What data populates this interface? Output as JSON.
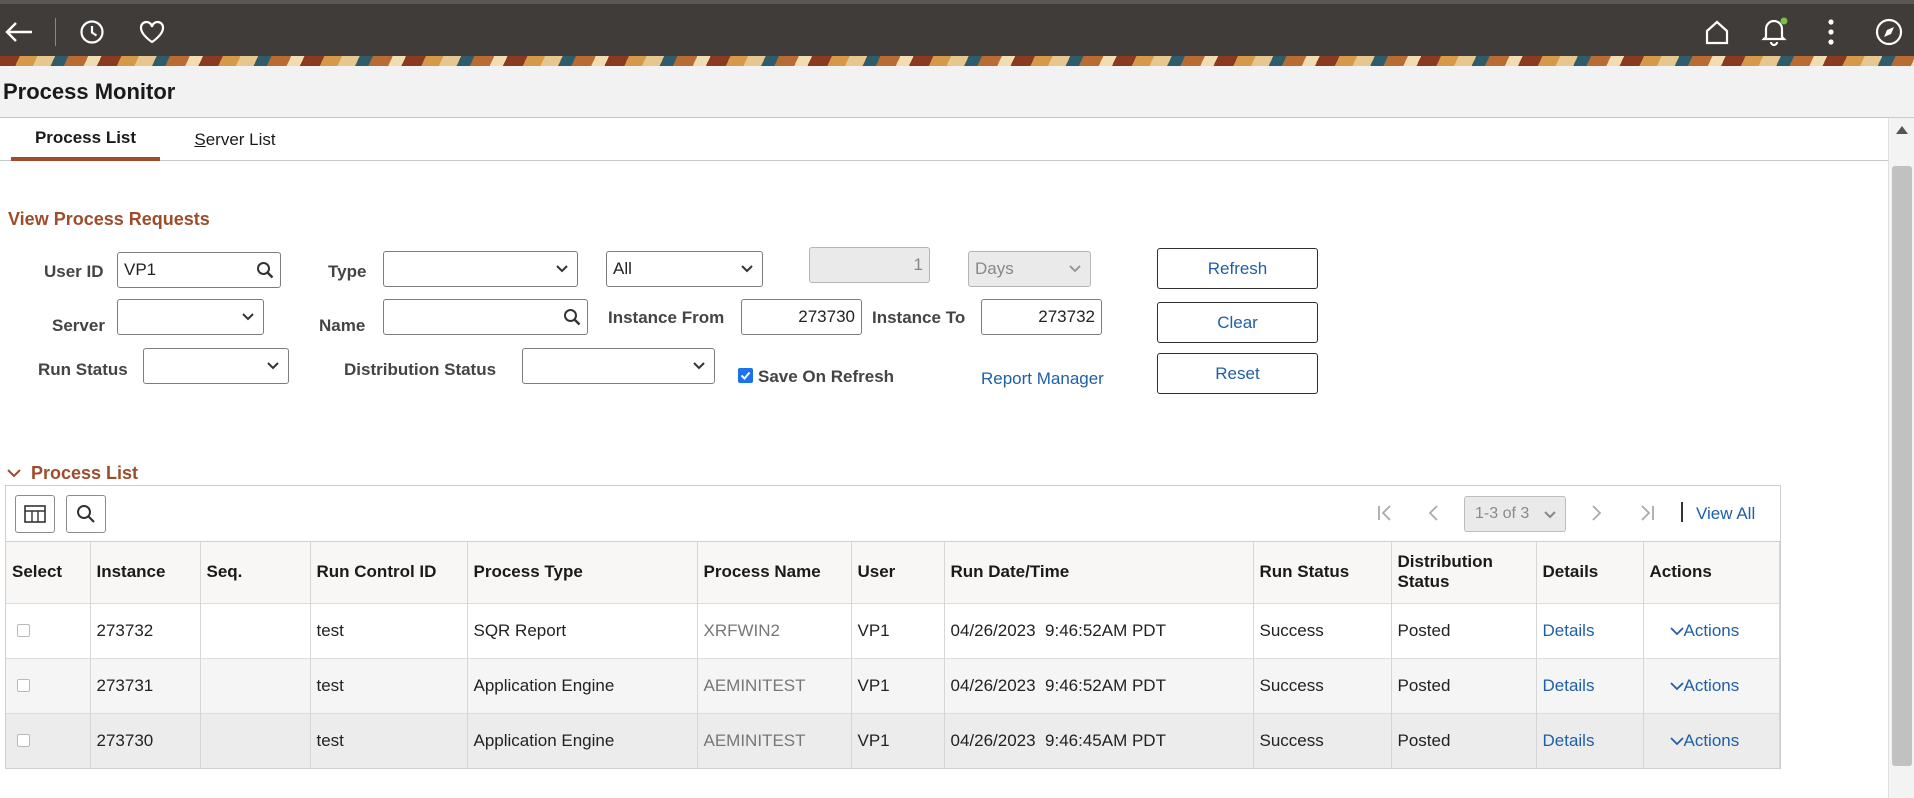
{
  "page": {
    "title": "Process Monitor"
  },
  "tabs": [
    {
      "label": "Process List",
      "active": true
    },
    {
      "label": "Server List",
      "active": false,
      "mnemonic": "S"
    }
  ],
  "filters": {
    "section_title": "View Process Requests",
    "user_id_label": "User ID",
    "user_id_value": "VP1",
    "type_label": "Type",
    "type_value": "",
    "scope_value": "All",
    "days_value": "1",
    "days_unit": "Days",
    "server_label": "Server",
    "server_value": "",
    "name_label": "Name",
    "name_value": "",
    "instance_from_label": "Instance From",
    "instance_from_value": "273730",
    "instance_to_label": "Instance To",
    "instance_to_value": "273732",
    "run_status_label": "Run Status",
    "run_status_value": "",
    "dist_status_label": "Distribution Status",
    "dist_status_value": "",
    "save_on_refresh_label": "Save On Refresh",
    "save_on_refresh_checked": true,
    "report_manager_link": "Report Manager"
  },
  "buttons": {
    "refresh": "Refresh",
    "clear": "Clear",
    "reset": "Reset"
  },
  "grid": {
    "title": "Process List",
    "pagination": "1-3 of 3",
    "view_all": "View All",
    "columns": [
      "Select",
      "Instance",
      "Seq.",
      "Run Control ID",
      "Process Type",
      "Process Name",
      "User",
      "Run Date/Time",
      "Run Status",
      "Distribution Status",
      "Details",
      "Actions"
    ],
    "rows": [
      {
        "instance": "273732",
        "seq": "",
        "run_control": "test",
        "process_type": "SQR Report",
        "process_name": "XRFWIN2",
        "user": "VP1",
        "run_datetime": "04/26/2023  9:46:52AM PDT",
        "run_status": "Success",
        "dist_status": "Posted",
        "details": "Details",
        "actions": "Actions"
      },
      {
        "instance": "273731",
        "seq": "",
        "run_control": "test",
        "process_type": "Application Engine",
        "process_name": "AEMINITEST",
        "user": "VP1",
        "run_datetime": "04/26/2023  9:46:52AM PDT",
        "run_status": "Success",
        "dist_status": "Posted",
        "details": "Details",
        "actions": "Actions"
      },
      {
        "instance": "273730",
        "seq": "",
        "run_control": "test",
        "process_type": "Application Engine",
        "process_name": "AEMINITEST",
        "user": "VP1",
        "run_datetime": "04/26/2023  9:46:45AM PDT",
        "run_status": "Success",
        "dist_status": "Posted",
        "details": "Details",
        "actions": "Actions"
      }
    ]
  },
  "icons": {
    "back": "back-arrow-icon",
    "history": "clock-icon",
    "favorites": "heart-icon",
    "home": "home-icon",
    "notifications": "bell-icon",
    "more": "kebab-menu-icon",
    "navigator": "compass-icon"
  },
  "colors": {
    "topbar": "#3f3c3a",
    "accent": "#9e4d2c",
    "link": "#1f5fa8",
    "notification_dot": "#7bc043"
  }
}
